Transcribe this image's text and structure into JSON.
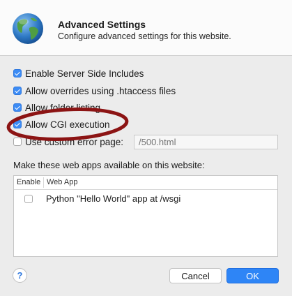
{
  "header": {
    "title": "Advanced Settings",
    "subtitle": "Configure advanced settings for this website.",
    "icon": "globe-icon"
  },
  "options": {
    "server_side_includes": {
      "label": "Enable Server Side Includes",
      "checked": true
    },
    "htaccess_overrides": {
      "label": "Allow overrides using .htaccess files",
      "checked": true
    },
    "folder_listing": {
      "label": "Allow folder listing",
      "checked": true
    },
    "cgi_execution": {
      "label": "Allow CGI execution",
      "checked": true
    },
    "custom_error_page": {
      "label": "Use custom error page:",
      "checked": false,
      "placeholder": "/500.html"
    }
  },
  "web_apps": {
    "section_label": "Make these web apps available on this website:",
    "columns": [
      "Enable",
      "Web App"
    ],
    "rows": [
      {
        "enabled": false,
        "name": "Python \"Hello World\" app at /wsgi"
      }
    ]
  },
  "footer": {
    "help_label": "?",
    "cancel_label": "Cancel",
    "ok_label": "OK"
  },
  "colors": {
    "accent": "#2e85f6",
    "annotation": "#8c1414"
  }
}
